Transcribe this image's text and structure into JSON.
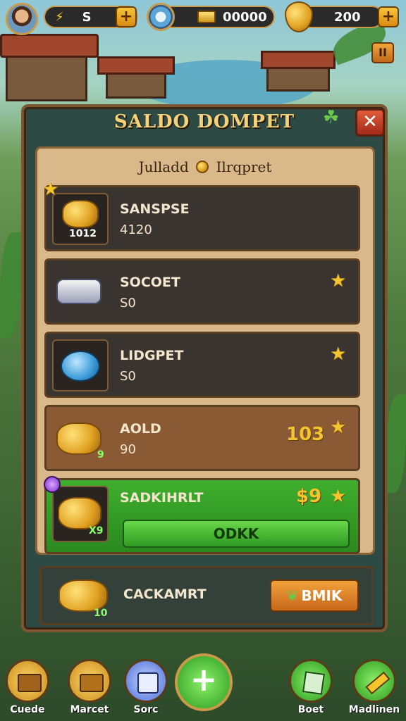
{
  "topbar": {
    "energy_value": "S",
    "gems_value": "00000",
    "gold_value": "200",
    "plus_label": "+"
  },
  "pause_label": "II",
  "panel": {
    "title": "SALDO DOMPET",
    "close_label": "✕",
    "subtitle_left": "Julladd",
    "subtitle_right": "Ilrqpret"
  },
  "rows": [
    {
      "name": "SANSPSE",
      "value": "4120",
      "badge": "1012",
      "icon": "gold-coins-icon"
    },
    {
      "name": "SOCOET",
      "value": "S0",
      "icon": "silver-bars-icon"
    },
    {
      "name": "LIDGPET",
      "value": "S0",
      "icon": "blue-coin-icon"
    },
    {
      "name": "AOLD",
      "value": "90",
      "amount": "103",
      "badge": "9",
      "icon": "gold-coins-icon"
    },
    {
      "name": "SADKIHRLT",
      "amount": "$9",
      "badge": "X9",
      "button": "ODKK",
      "icon": "gold-coins-icon"
    }
  ],
  "bottom_row": {
    "name": "CACKAMRT",
    "badge": "10",
    "button": "BMIK"
  },
  "nav": [
    {
      "label": "Cuede"
    },
    {
      "label": "Marcet"
    },
    {
      "label": "Sorc"
    },
    {
      "label": "+"
    },
    {
      "label": "Boet"
    },
    {
      "label": "Madlinen"
    }
  ],
  "colors": {
    "accent_gold": "#f4d27a",
    "panel_bg": "#2e4a44",
    "highlight_green": "#3fae2e",
    "button_orange": "#e58a2a"
  }
}
